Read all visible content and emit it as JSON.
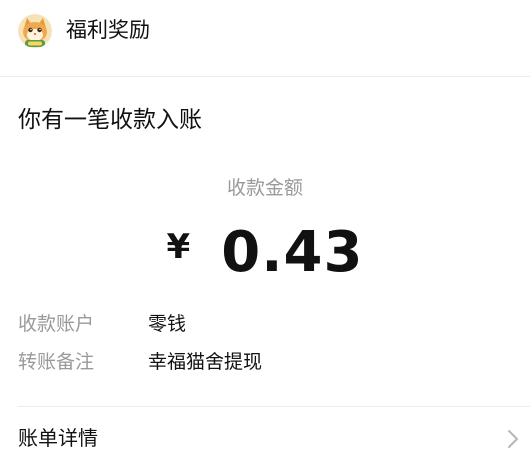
{
  "header": {
    "title": "福利奖励",
    "avatar_icon": "cat-avatar-icon"
  },
  "message": {
    "title": "你有一笔收款入账"
  },
  "amount": {
    "label": "收款金额",
    "currency": "¥",
    "value": "0.43"
  },
  "details": [
    {
      "label": "收款账户",
      "value": "零钱"
    },
    {
      "label": "转账备注",
      "value": "幸福猫舍提现"
    }
  ],
  "bill": {
    "label": "账单详情",
    "icon": "chevron-right-icon"
  },
  "colors": {
    "text_primary": "#111111",
    "text_secondary": "#9a9a9a",
    "divider": "#ececec",
    "background": "#ffffff"
  }
}
